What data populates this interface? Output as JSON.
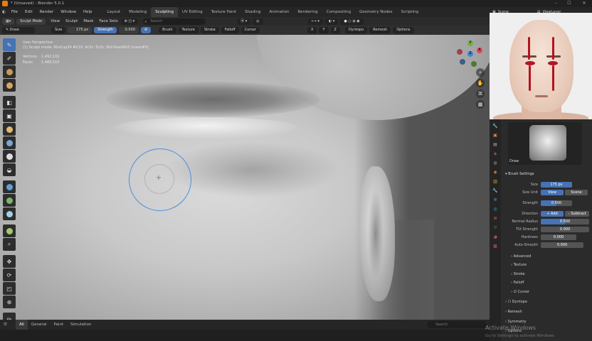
{
  "window": {
    "title": "* (Unsaved) - Blender 5.0.1",
    "controls": [
      "–",
      "☐",
      "✕"
    ]
  },
  "menubar": {
    "items": [
      "File",
      "Edit",
      "Render",
      "Window",
      "Help"
    ],
    "workspaces": [
      "Layout",
      "Modeling",
      "Sculpting",
      "UV Editing",
      "Texture Paint",
      "Shading",
      "Animation",
      "Rendering",
      "Compositing",
      "Geometry Nodes",
      "Scripting"
    ],
    "active_workspace": "Sculpting",
    "scene": "Scene",
    "view_layer": "ViewLayer"
  },
  "header": {
    "mode": "Sculpt Mode",
    "menus": [
      "View",
      "Sculpt",
      "Mask",
      "Face Sets"
    ],
    "search_placeholder": "Search",
    "active_tool": "Draw",
    "size_label": "Size",
    "size_value": "175 px",
    "strength_label": "Strength",
    "strength_value": "0.500",
    "dropdowns": [
      "Brush",
      "Texture",
      "Stroke",
      "Falloff",
      "Cursor"
    ],
    "axes": [
      "X",
      "Y",
      "Z"
    ],
    "dyntopo": "Dyntopo",
    "remesh": "Remesh",
    "options": "Options"
  },
  "viewport": {
    "view_name": "User Perspective",
    "object_info": "(1) Sculpt mode: RhsCup34 #210: 4c3c: 5c5c: Bld-Head4b3 (mesh#0)",
    "vertices_label": "Vertices",
    "vertices_value": "1,492,102",
    "faces_label": "Faces",
    "faces_value": "1,489,510",
    "gizmo": [
      "X",
      "Y",
      "Z"
    ]
  },
  "bottombar": {
    "tabs": [
      "All",
      "General",
      "Paint",
      "Simulation"
    ],
    "active_tab": "All",
    "search_placeholder": "Search"
  },
  "properties": {
    "brush_name": "Draw",
    "brush_settings_label": "Brush Settings",
    "rows": [
      {
        "label": "Size",
        "value": "175 px"
      },
      {
        "label": "Size Unit",
        "value": "View",
        "alt": "Scene"
      },
      {
        "label": "Strength",
        "value": "0.500"
      },
      {
        "label": "Direction",
        "value": "+ Add",
        "alt": "– Subtract"
      },
      {
        "label": "Normal Radius",
        "value": "0.500"
      },
      {
        "label": "Tilt Strength",
        "value": "0.000"
      },
      {
        "label": "Hardness",
        "value": "0.000"
      },
      {
        "label": "Auto-Smooth",
        "value": "0.000"
      }
    ],
    "subsections": [
      "Advanced",
      "Texture",
      "Stroke",
      "Falloff",
      "Cursor"
    ],
    "panels": [
      "Dyntopo",
      "Remesh",
      "Symmetry",
      "Options"
    ]
  },
  "watermark": {
    "line1": "Activate Windows",
    "line2": "Go to Settings to activate Windows."
  },
  "colors": {
    "accent": "#4772b3",
    "brush_circle": "#4b8fe0",
    "blood_red": "#b3131f"
  }
}
